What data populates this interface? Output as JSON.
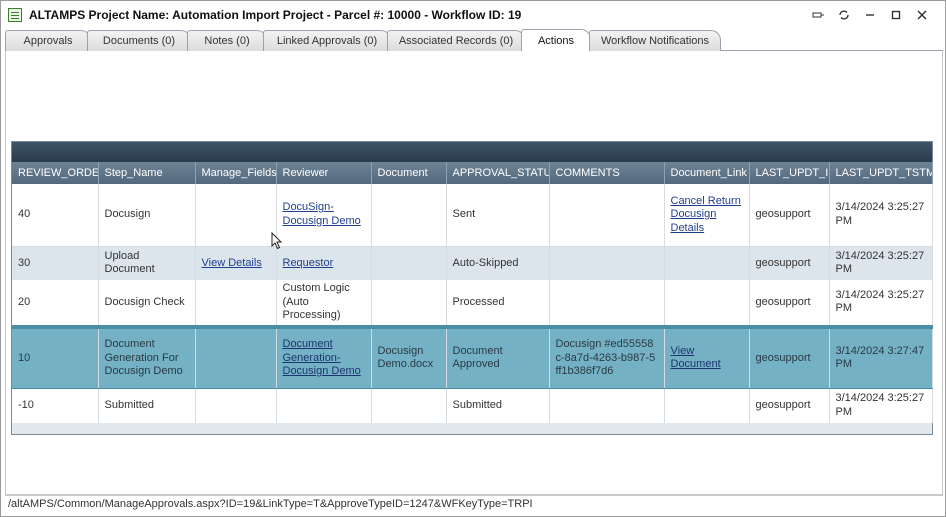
{
  "window": {
    "title": "ALTAMPS Project Name: Automation Import Project - Parcel #: 10000 - Workflow ID: 19",
    "controls": [
      "pin-icon",
      "restore-alt-icon",
      "minimize-icon",
      "maximize-icon",
      "close-icon"
    ]
  },
  "tabs": [
    {
      "label": "Approvals"
    },
    {
      "label": "Documents (0)"
    },
    {
      "label": "Notes (0)"
    },
    {
      "label": "Linked Approvals (0)"
    },
    {
      "label": "Associated Records (0)"
    },
    {
      "label": "Actions",
      "active": true
    },
    {
      "label": "Workflow Notifications"
    }
  ],
  "grid": {
    "columns": [
      "REVIEW_ORDER",
      "Step_Name",
      "Manage_Fields",
      "Reviewer",
      "Document",
      "APPROVAL_STATUS",
      "COMMENTS",
      "Document_Link",
      "LAST_UPDT_ID",
      "LAST_UPDT_TSTMP"
    ],
    "rows": [
      {
        "review_order": "40",
        "step_name": "Docusign",
        "manage_fields": "",
        "reviewer": "DocuSign-Docusign Demo",
        "document": "",
        "approval_status": "Sent",
        "comments": "",
        "document_link": "Cancel Return Docusign Details",
        "last_updt_id": "geosupport",
        "last_updt_tstmp": "3/14/2024 3:25:27 PM"
      },
      {
        "review_order": "30",
        "step_name": "Upload Document",
        "manage_fields": "View Details",
        "reviewer": "Requestor",
        "document": "",
        "approval_status": "Auto-Skipped",
        "comments": "",
        "document_link": "",
        "last_updt_id": "geosupport",
        "last_updt_tstmp": "3/14/2024 3:25:27 PM"
      },
      {
        "review_order": "20",
        "step_name": "Docusign Check",
        "manage_fields": "",
        "reviewer": "Custom Logic (Auto Processing)",
        "document": "",
        "approval_status": "Processed",
        "comments": "",
        "document_link": "",
        "last_updt_id": "geosupport",
        "last_updt_tstmp": "3/14/2024 3:25:27 PM"
      },
      {
        "review_order": "10",
        "step_name": "Document Generation For Docusign Demo",
        "manage_fields": "",
        "reviewer": "Document Generation-Docusign Demo",
        "document": "Docusign Demo.docx",
        "approval_status": "Document Approved",
        "comments": "Docusign #ed55558c-8a7d-4263-b987-5ff1b386f7d6",
        "document_link": "View Document",
        "last_updt_id": "geosupport",
        "last_updt_tstmp": "3/14/2024 3:27:47 PM"
      },
      {
        "review_order": "-10",
        "step_name": "Submitted",
        "manage_fields": "",
        "reviewer": "",
        "document": "",
        "approval_status": "Submitted",
        "comments": "",
        "document_link": "",
        "last_updt_id": "geosupport",
        "last_updt_tstmp": "3/14/2024 3:25:27 PM"
      }
    ]
  },
  "statusbar": {
    "url": "/altAMPS/Common/ManageApprovals.aspx?ID=19&LinkType=T&ApproveTypeID=1247&WFKeyType=TRPI"
  },
  "colors": {
    "header_bar": "#2a3b4c",
    "column_header": "#5f7589",
    "selected_row": "#74b1c4",
    "alt_row": "#dde5ec",
    "link": "#1f3f8f"
  }
}
